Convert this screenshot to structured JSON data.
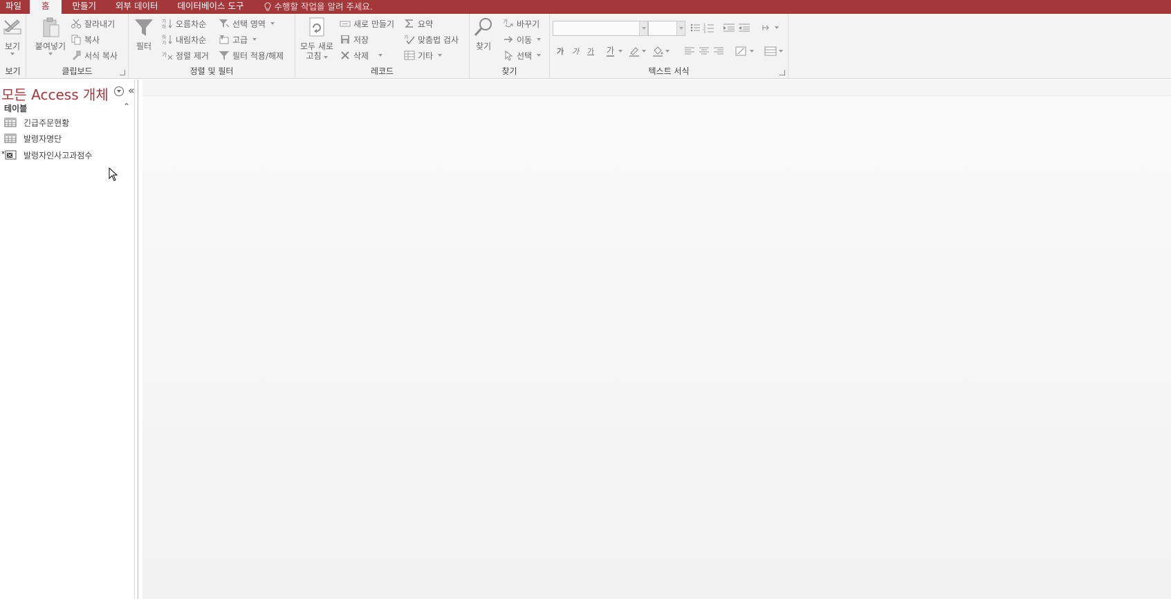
{
  "menubar": {
    "tabs": [
      {
        "label": "파일"
      },
      {
        "label": "홈"
      },
      {
        "label": "만들기"
      },
      {
        "label": "외부 데이터"
      },
      {
        "label": "데이터베이스 도구"
      }
    ],
    "tell_me": "수행할 작업을 알려 주세요."
  },
  "ribbon": {
    "view": {
      "label": "보기",
      "group": "보기"
    },
    "clipboard": {
      "paste": "붙여넣기",
      "cut": "잘라내기",
      "copy": "복사",
      "format_painter": "서식 복사",
      "group": "클립보드"
    },
    "sort_filter": {
      "filter": "필터",
      "ascending": "오름차순",
      "descending": "내림차순",
      "remove_sort": "정렬 제거",
      "selection": "선택 영역",
      "advanced": "고급",
      "toggle_filter": "필터 적용/해제",
      "group": "정렬 및 필터"
    },
    "records": {
      "refresh_line1": "모두 새로",
      "refresh_line2": "고침",
      "new": "새로 만들기",
      "save": "저장",
      "delete": "삭제",
      "totals": "요약",
      "spelling": "맞춤법 검사",
      "more": "기타",
      "group": "레코드"
    },
    "find": {
      "find": "찾기",
      "replace": "바꾸기",
      "goto": "이동",
      "select": "선택",
      "group": "찾기"
    },
    "text_format": {
      "bold": "가",
      "italic": "가",
      "underline": "가",
      "font_color": "가",
      "group": "텍스트 서식"
    }
  },
  "navpane": {
    "title": "모든 Access 개체",
    "collapse_glyph": "«",
    "group_header": "테이블",
    "group_collapse_glyph": "⌃",
    "items": [
      {
        "label": "긴급주문현황",
        "icon": "table-icon"
      },
      {
        "label": "발령자명단",
        "icon": "table-icon"
      },
      {
        "label": "발령자인사고과점수",
        "icon": "linked-excel-table-icon"
      }
    ]
  },
  "colors": {
    "accent": "#a4373a",
    "ribbon_bg": "#f3f3f3"
  }
}
